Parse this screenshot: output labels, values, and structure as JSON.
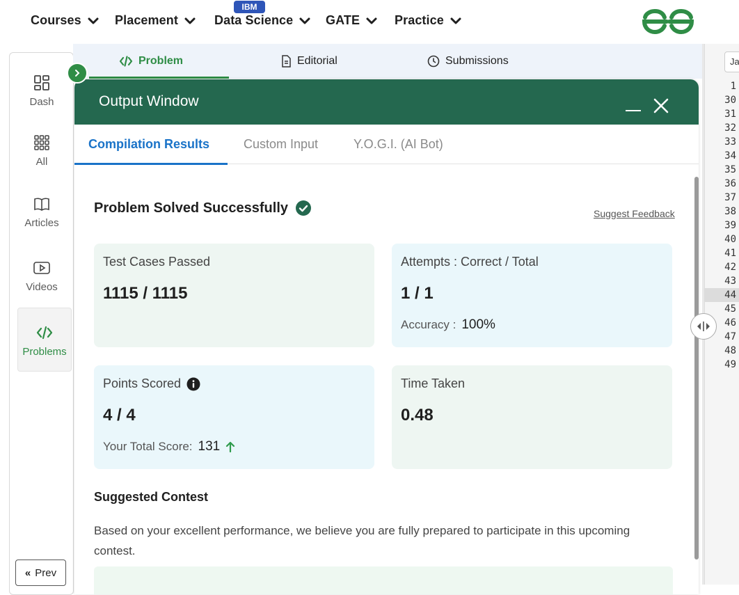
{
  "nav": {
    "items": [
      {
        "label": "Courses"
      },
      {
        "label": "Placement"
      },
      {
        "label": "Data Science"
      },
      {
        "label": "GATE"
      },
      {
        "label": "Practice"
      }
    ],
    "ibm_badge": "IBM",
    "logo_icon": "gfg-logo-icon",
    "brand_color": "#2f8d46"
  },
  "sidebar": {
    "items": [
      {
        "label": "Dash",
        "icon": "dashboard-icon"
      },
      {
        "label": "All",
        "icon": "grid-icon"
      },
      {
        "label": "Articles",
        "icon": "book-icon"
      },
      {
        "label": "Videos",
        "icon": "video-icon"
      },
      {
        "label": "Problems",
        "icon": "code-icon",
        "active": true
      }
    ],
    "prev_label": "Prev"
  },
  "problem_tabs": [
    {
      "label": "Problem",
      "icon": "code-icon",
      "active": true
    },
    {
      "label": "Editorial",
      "icon": "document-icon"
    },
    {
      "label": "Submissions",
      "icon": "clock-icon"
    }
  ],
  "output": {
    "title": "Output Window",
    "header_color": "#24684f",
    "tabs": [
      {
        "label": "Compilation Results",
        "active": true
      },
      {
        "label": "Custom Input"
      },
      {
        "label": "Y.O.G.I. (AI Bot)"
      }
    ],
    "status": "Problem Solved Successfully",
    "feedback_link": "Suggest Feedback",
    "cards": {
      "tests": {
        "label": "Test Cases Passed",
        "value": "1115 / 1115"
      },
      "attempts": {
        "label": "Attempts : Correct / Total",
        "value": "1 / 1",
        "sub_label": "Accuracy :",
        "sub_value": "100%"
      },
      "points": {
        "label": "Points Scored",
        "value": "4 / 4",
        "sub_label": "Your Total Score:",
        "sub_value": "131"
      },
      "time": {
        "label": "Time Taken",
        "value": "0.48"
      }
    },
    "contest": {
      "heading": "Suggested Contest",
      "text": "Based on your excellent performance, we believe you are fully prepared to participate in this upcoming contest."
    }
  },
  "editor": {
    "lang_label": "Ja",
    "line_numbers": [
      "1",
      "30",
      "31",
      "32",
      "33",
      "34",
      "35",
      "36",
      "37",
      "38",
      "39",
      "40",
      "41",
      "42",
      "43",
      "44",
      "45",
      "46",
      "47",
      "48",
      "49"
    ],
    "highlighted_line": "44"
  }
}
